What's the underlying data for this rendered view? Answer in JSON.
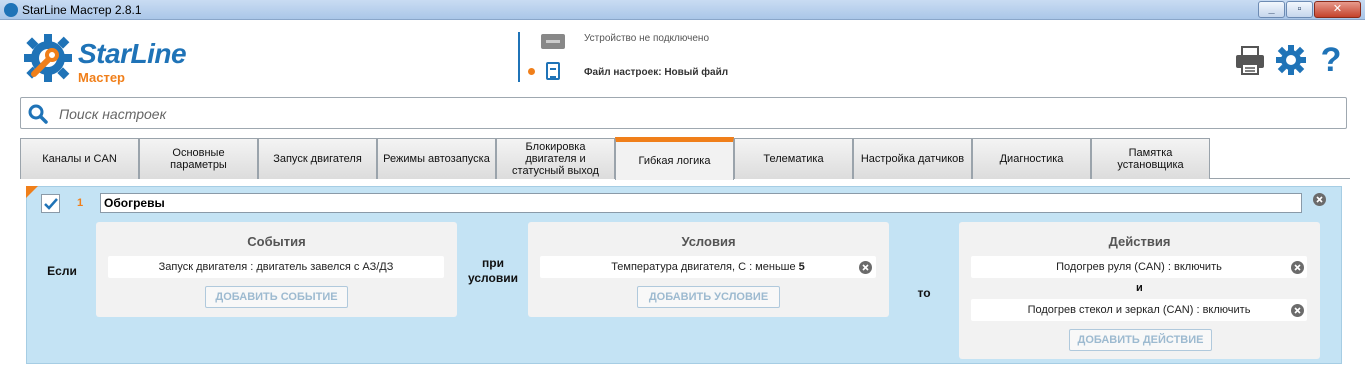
{
  "window": {
    "title": "StarLine Мастер 2.8.1"
  },
  "logo": {
    "name": "StarLine",
    "sub": "Мастер"
  },
  "status": {
    "device": "Устройство не подключено",
    "file": "Файл настроек: Новый файл"
  },
  "header_icons": [
    "printer-icon",
    "gear-icon",
    "help-icon"
  ],
  "search": {
    "placeholder": "Поиск настроек"
  },
  "tabs": [
    {
      "label": "Каналы и CAN"
    },
    {
      "label": "Основные параметры"
    },
    {
      "label": "Запуск двигателя"
    },
    {
      "label": "Режимы автозапуска"
    },
    {
      "label": "Блокировка двигателя и статусный выход"
    },
    {
      "label": "Гибкая логика",
      "active": true
    },
    {
      "label": "Телематика"
    },
    {
      "label": "Настройка датчиков"
    },
    {
      "label": "Диагностика"
    },
    {
      "label": "Памятка установщика"
    }
  ],
  "rule": {
    "number": "1",
    "name": "Обогревы",
    "checked": true,
    "if_label": "Если",
    "pri_label": "при",
    "usl_label": "условии",
    "to_label": "то",
    "events": {
      "title": "События",
      "items": [
        "Запуск двигателя : двигатель завелся с АЗ/ДЗ"
      ],
      "add_label": "ДОБАВИТЬ СОБЫТИЕ"
    },
    "conditions": {
      "title": "Условия",
      "items": [
        {
          "text": "Температура двигателя, С : меньше ",
          "value": "5"
        }
      ],
      "add_label": "ДОБАВИТЬ УСЛОВИЕ"
    },
    "actions": {
      "title": "Действия",
      "items": [
        "Подогрев руля (CAN) : включить",
        "Подогрев стекол и зеркал (CAN) : включить"
      ],
      "joiner": "и",
      "add_label": "ДОБАВИТЬ ДЕЙСТВИЕ"
    }
  },
  "colors": {
    "brand_blue": "#1f73b7",
    "accent_orange": "#f07f1a",
    "panel_bg": "#c4e3f4"
  }
}
